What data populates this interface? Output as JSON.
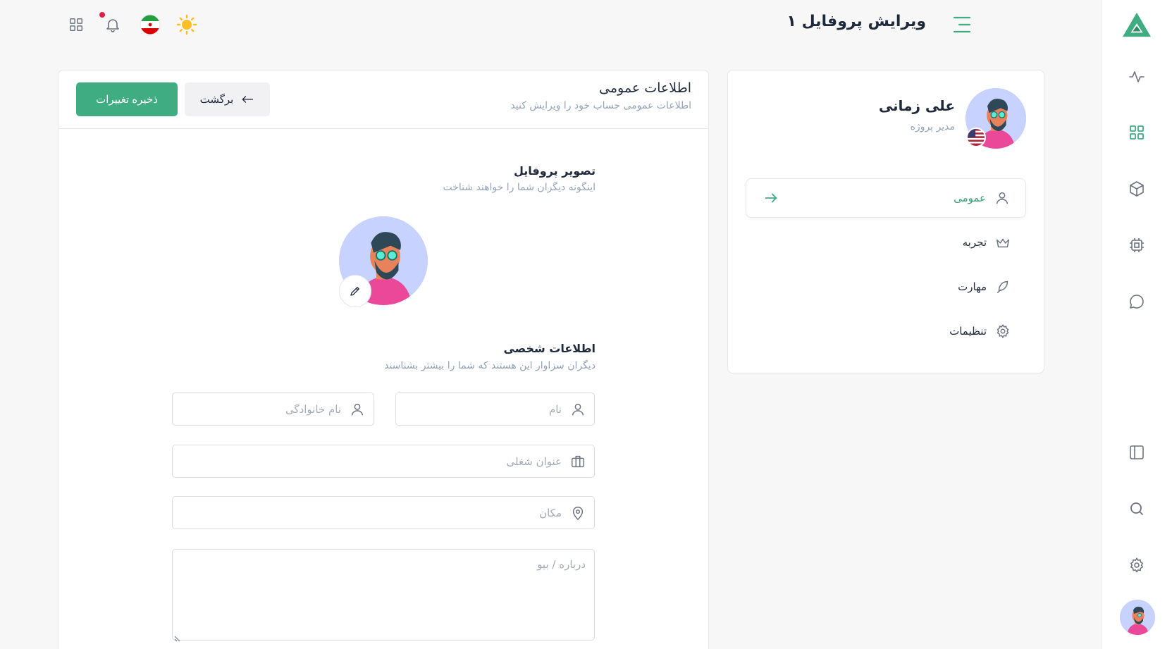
{
  "header": {
    "title": "ویرایش پروفایل ۱"
  },
  "profile": {
    "name": "علی زمانی",
    "role": "مدیر پروژه"
  },
  "side_menu": [
    {
      "label": "عمومی",
      "icon": "user-icon",
      "active": true
    },
    {
      "label": "تجربه",
      "icon": "crown-icon",
      "active": false
    },
    {
      "label": "مهارت",
      "icon": "feather-icon",
      "active": false
    },
    {
      "label": "تنظیمات",
      "icon": "gear-icon",
      "active": false
    }
  ],
  "main": {
    "title": "اطلاعات عمومی",
    "subtitle": "اطلاعات عمومی حساب خود را ویرایش کنید",
    "save_label": "ذخیره تغییرات",
    "back_label": "برگشت",
    "avatar_section": {
      "title": "تصویر پروفایل",
      "subtitle": "اینگونه دیگران شما را خواهند شناخت"
    },
    "personal_section": {
      "title": "اطلاعات شخصی",
      "subtitle": "دیگران سزاوار این هستند که شما را بیشتر بشناسند"
    },
    "fields": {
      "first_name_placeholder": "نام",
      "last_name_placeholder": "نام خانوادگی",
      "job_title_placeholder": "عنوان شغلی",
      "location_placeholder": "مکان",
      "bio_placeholder": "درباره / بیو"
    }
  },
  "colors": {
    "accent": "#3fac81",
    "notification_dot": "#e11d48"
  }
}
